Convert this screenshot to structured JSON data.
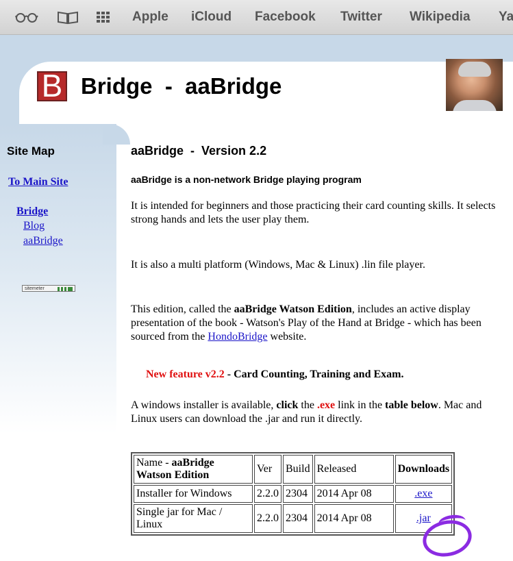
{
  "bookmarks_bar": {
    "icons": [
      "reader-glasses-icon",
      "book-icon",
      "grid-icon"
    ],
    "links": [
      "Apple",
      "iCloud",
      "Facebook",
      "Twitter",
      "Wikipedia",
      "Ya"
    ]
  },
  "header": {
    "logo_letter": "B",
    "title": "Bridge  -  aaBridge"
  },
  "sidebar": {
    "heading": "Site Map",
    "main_site_link": "To Main Site",
    "section_link": "Bridge",
    "items": [
      "Blog",
      "aaBridge"
    ],
    "badge_text": "sitemeter"
  },
  "main": {
    "heading": "aaBridge  -  Version 2.2",
    "subheading": "aaBridge is a non-network Bridge playing program",
    "para1": "It is intended for beginners and those practicing their card counting skills. It selects strong hands and lets the user play them.",
    "para2": "It is also a multi platform (Windows, Mac & Linux) .lin file player.",
    "para3": {
      "before": "This edition, called the ",
      "bold": "aaBridge Watson Edition",
      "middle": ", includes an active display presentation of the book - Watson's Play of the Hand at Bridge - which has been sourced from the ",
      "link": "HondoBridge",
      "after": " website."
    },
    "feature": {
      "red": "New feature v2.2",
      "rest": " - Card Counting, Training and Exam."
    },
    "para4": {
      "a": "A windows installer is available, ",
      "b": "click",
      "c": " the ",
      "d": ".exe",
      "e": " link in the ",
      "f": "table below",
      "g": ". Mac and Linux users can download the .jar and run it directly."
    }
  },
  "download_table": {
    "headers": {
      "name_prefix": "Name - ",
      "name_bold": "aaBridge Watson Edition",
      "ver": "Ver",
      "build": "Build",
      "released": "Released",
      "downloads": "Downloads"
    },
    "rows": [
      {
        "name": "Installer for Windows",
        "ver": "2.2.0",
        "build": "2304",
        "released": "2014 Apr 08",
        "link": ".exe"
      },
      {
        "name": "Single jar for Mac / Linux",
        "ver": "2.2.0",
        "build": "2304",
        "released": "2014 Apr 08",
        "link": ".jar"
      }
    ]
  },
  "annotation_color": "#8b2be2"
}
